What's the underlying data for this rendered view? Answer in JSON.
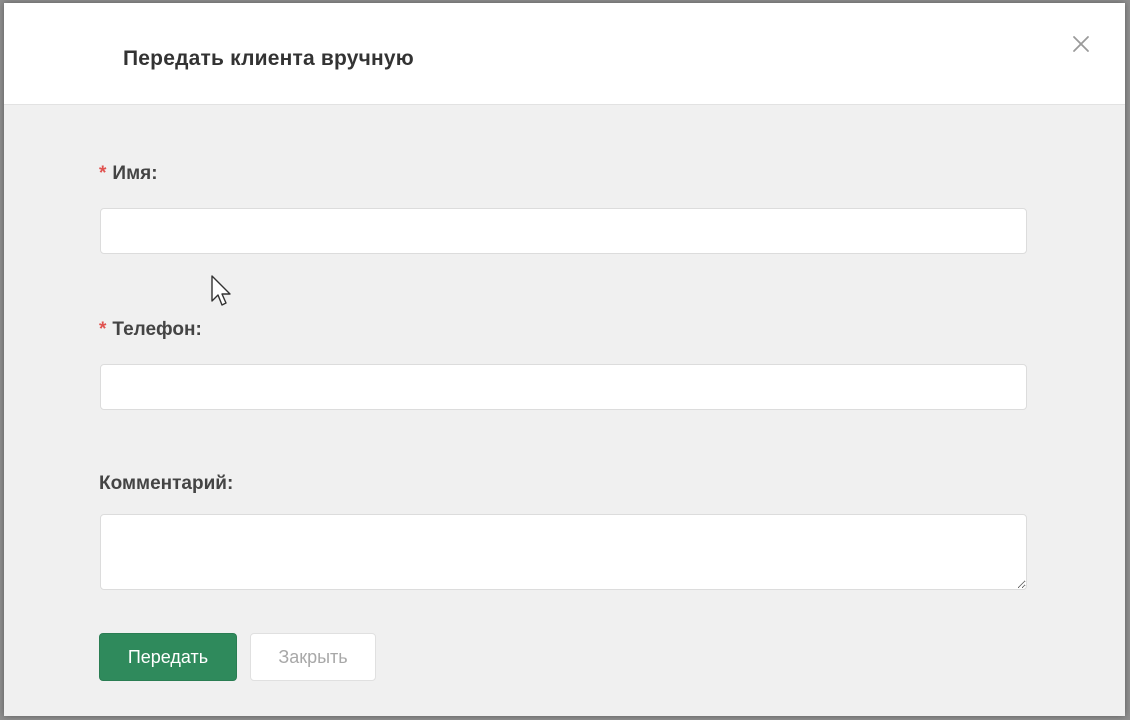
{
  "dialog": {
    "title": "Передать клиента вручную",
    "close_icon": "close-icon"
  },
  "form": {
    "name": {
      "required_mark": "*",
      "label": "Имя:",
      "value": "",
      "placeholder": ""
    },
    "phone": {
      "required_mark": "*",
      "label": "Телефон:",
      "value": "",
      "placeholder": ""
    },
    "comment": {
      "label": "Комментарий:",
      "value": "",
      "placeholder": ""
    }
  },
  "actions": {
    "submit_label": "Передать",
    "close_label": "Закрыть"
  },
  "colors": {
    "primary_button": "#2f8a5c",
    "required_mark": "#e0524f",
    "body_background": "#f0f0f0",
    "header_background": "#ffffff"
  }
}
